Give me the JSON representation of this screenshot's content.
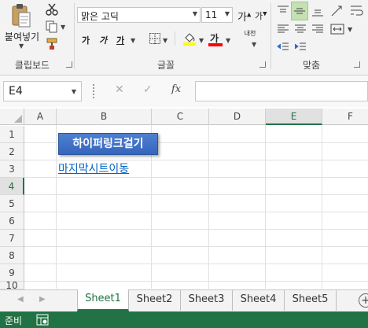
{
  "ribbon": {
    "clipboard": {
      "paste_label": "붙여넣기",
      "group_label": "클립보드"
    },
    "font": {
      "font_name": "맑은 고딕",
      "font_size": "11",
      "grow_glyph": "가",
      "shrink_glyph": "가",
      "bold_glyph": "가",
      "italic_glyph": "가",
      "underline_glyph": "가",
      "font_color_glyph": "가",
      "phonetic_glyph": "내천",
      "highlight_color": "#ffff00",
      "font_color": "#ff0000",
      "group_label": "글꼴"
    },
    "alignment": {
      "group_label": "맞춤"
    }
  },
  "formula_bar": {
    "name_box": "E4",
    "cancel_glyph": "✕",
    "enter_glyph": "✓",
    "fx_label": "fx",
    "formula": ""
  },
  "grid": {
    "columns": [
      "A",
      "B",
      "C",
      "D",
      "E",
      "F"
    ],
    "rows": [
      "1",
      "2",
      "3",
      "4",
      "5",
      "6",
      "7",
      "8",
      "9",
      "10"
    ],
    "shape_button_label": "하이퍼링크걸기",
    "hyperlink_text": "마지막시트이동"
  },
  "sheet_tabs": [
    "Sheet1",
    "Sheet2",
    "Sheet3",
    "Sheet4",
    "Sheet5"
  ],
  "status": {
    "ready": "준비"
  },
  "colors": {
    "excel_green": "#217346",
    "link_blue": "#0563c1",
    "shape_blue": "#3566bd"
  }
}
